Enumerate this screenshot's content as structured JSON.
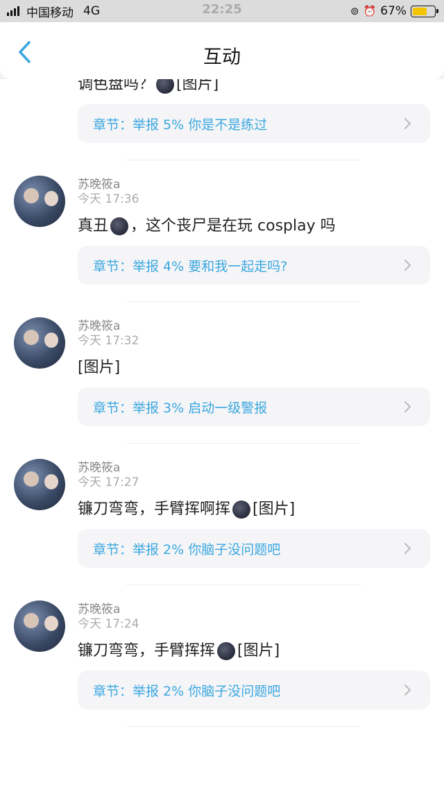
{
  "status_bar": {
    "carrier": "中国移动",
    "network": "4G",
    "time": "22:25",
    "battery": "67%",
    "battery_level": 0.67
  },
  "nav": {
    "title": "互动"
  },
  "items": [
    {
      "message_tail": "调色盘吗？",
      "message_suffix": "[图片]",
      "chapter": "章节：举报 5% 你是不是练过"
    },
    {
      "user": "苏晚筱a",
      "time": "今天 17:36",
      "message_pre": "真丑",
      "message_post": "，这个丧尸是在玩 cosplay 吗",
      "chapter": "章节：举报 4% 要和我一起走吗?"
    },
    {
      "user": "苏晚筱a",
      "time": "今天 17:32",
      "message": "[图片]",
      "chapter": "章节：举报 3% 启动一级警报"
    },
    {
      "user": "苏晚筱a",
      "time": "今天 17:27",
      "message_pre": "镰刀弯弯，手臂挥啊挥",
      "message_post": "[图片]",
      "chapter": "章节：举报 2% 你脑子没问题吧"
    },
    {
      "user": "苏晚筱a",
      "time": "今天 17:24",
      "message_pre": "镰刀弯弯，手臂挥挥",
      "message_post": "[图片]",
      "chapter": "章节：举报 2% 你脑子没问题吧"
    }
  ],
  "colors": {
    "accent": "#3aa7e0",
    "battery_fill": "#f5c400"
  }
}
